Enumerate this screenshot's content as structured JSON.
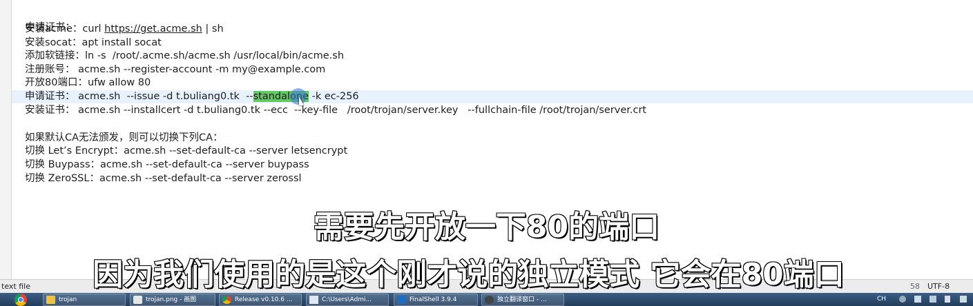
{
  "editor": {
    "lines": [
      {
        "text": "申请证书："
      },
      {
        "label": "安装acme：",
        "cmd": "curl ",
        "url": "https://get.acme.sh",
        "rest": " | sh"
      },
      {
        "label": "安装socat：",
        "cmd": "apt install socat"
      },
      {
        "label": "添加软链接：",
        "cmd": "ln -s  /root/.acme.sh/acme.sh /usr/local/bin/acme.sh"
      },
      {
        "label": "注册账号：",
        "cmd": " acme.sh --register-account -m my@example.com"
      },
      {
        "label": "开放80端口：",
        "cmd": "ufw allow 80"
      },
      {
        "label": "申请证书：",
        "cmd_before": " acme.sh  --issue -d t.buliang0.tk  --",
        "selected": "standalone",
        "cmd_after": " -k ec-256"
      },
      {
        "label": "安装证书：",
        "cmd": " acme.sh --installcert -d t.buliang0.tk --ecc  --key-file   /root/trojan/server.key   --fullchain-file /root/trojan/server.crt"
      },
      {
        "text": ""
      },
      {
        "label": "如果默认CA无法颁发，则可以切换下列CA：",
        "cmd": ""
      },
      {
        "label": "切换 Let’s Encrypt：",
        "cmd": "acme.sh --set-default-ca --server letsencrypt"
      },
      {
        "label": "切换 Buypass：",
        "cmd": "acme.sh --set-default-ca --server buypass"
      },
      {
        "label": "切换 ZeroSSL：",
        "cmd": "acme.sh --set-default-ca --server zerossl"
      }
    ]
  },
  "statusbar": {
    "file_type": "text file",
    "position": "58",
    "encoding": "UTF-8"
  },
  "taskbar": {
    "items": [
      {
        "label": "trojan",
        "icon": "folder-icon"
      },
      {
        "label": "trojan.png - 画图",
        "icon": "paint-icon"
      },
      {
        "label": "Release v0.10.6 ...",
        "icon": "chrome-icon"
      },
      {
        "label": "C:\\Users\\Admi...",
        "icon": "notepad-icon"
      },
      {
        "label": "FinalShell 3.9.4",
        "icon": "terminal-icon"
      },
      {
        "label": "独立翻译窗口 - ...",
        "icon": "translate-icon"
      }
    ],
    "tray": {
      "lang": "CH"
    }
  },
  "subtitles": {
    "line1": "需要先开放一下80的端口",
    "line2": "因为我们使用的是这个刚才说的独立模式 它会在80端口"
  },
  "colors": {
    "selection": "#64c864",
    "current_line": "#e8f2fe",
    "taskbar": "#2f4d70"
  }
}
